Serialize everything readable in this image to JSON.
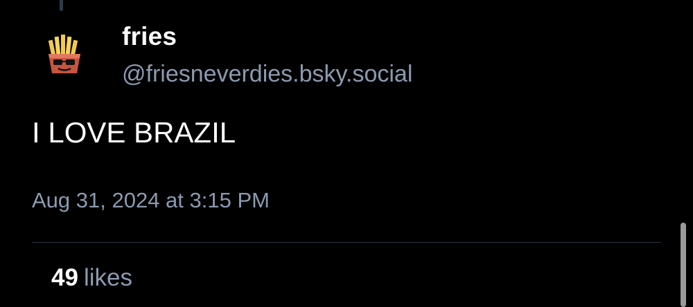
{
  "post": {
    "author": {
      "display_name": "fries",
      "handle": "@friesneverdies.bsky.social",
      "avatar_icon": "fries-avatar-icon"
    },
    "text": "I LOVE BRAZIL",
    "timestamp": "Aug 31, 2024 at 3:15 PM",
    "stats": {
      "likes_count": "49",
      "likes_label": "likes"
    }
  },
  "colors": {
    "background": "#000000",
    "primary_text": "#ffffff",
    "secondary_text": "#8b9bb0",
    "divider": "#2a3340"
  }
}
